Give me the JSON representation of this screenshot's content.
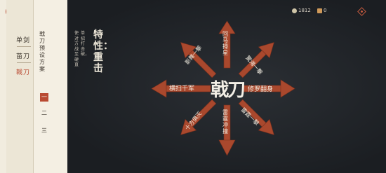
{
  "nav": {
    "back_icon": "back-arrow-icon",
    "back_glyph": "⇐"
  },
  "weapons": [
    {
      "label": "单剑",
      "active": false
    },
    {
      "label": "苗刀",
      "active": false
    },
    {
      "label": "戟刀",
      "active": true
    }
  ],
  "preset": {
    "title": "戟刀预设方案",
    "options": [
      {
        "label": "一",
        "active": true
      },
      {
        "label": "二",
        "active": false
      },
      {
        "label": "三",
        "active": false
      }
    ]
  },
  "trait": {
    "title": "特性：重击",
    "desc_line1": "单招打击破，",
    "desc_line2": "使对方战至硬直"
  },
  "resources": [
    {
      "value": "1812",
      "icon": "coin-icon",
      "color": "#cfc5a8"
    },
    {
      "value": "0",
      "icon": "gem-icon",
      "color": "#d09a5a"
    }
  ],
  "settings_icon": "settings-icon",
  "center_label": "戟刀",
  "moves": {
    "up": "回马掃星",
    "up_right": "驚鴻一擊",
    "right": "修罗翻身",
    "down_right": "雷霆一擊",
    "down": "雷霆冲撞",
    "down_left": "十方俱灭",
    "left": "横扫千军",
    "up_left": "影舞一擊"
  },
  "colors": {
    "accent": "#b94a32",
    "arrow": "#a9482d",
    "panel": "#ece6d6",
    "dark": "#1f2226"
  }
}
